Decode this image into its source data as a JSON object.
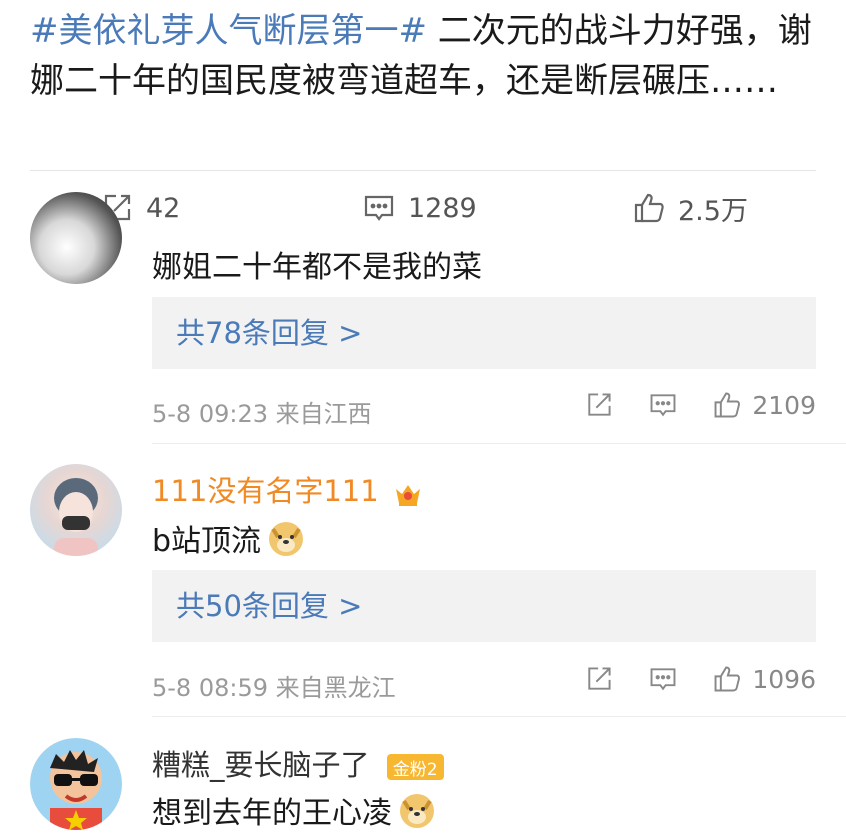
{
  "post": {
    "hashtag": "#美依礼芽人气断层第一#",
    "text": " 二次元的战斗力好强，谢娜二十年的国民度被弯道超车，还是断层碾压……"
  },
  "post_actions": {
    "repost_count": "42",
    "comment_count": "1289",
    "like_count": "2.5万"
  },
  "comments": [
    {
      "username": "",
      "text": "娜姐二十年都不是我的菜",
      "replies": "共78条回复 >",
      "time": "5-8 09:23",
      "location": "来自江西",
      "likes": "2109"
    },
    {
      "username": "111没有名字111",
      "text": "b站顶流",
      "replies": "共50条回复 >",
      "time": "5-8 08:59",
      "location": "来自黑龙江",
      "likes": "1096",
      "name_color": "#f08a24"
    },
    {
      "username": "糟糕_要长脑子了",
      "badge": "金粉2",
      "text": "想到去年的王心凌"
    }
  ],
  "icons": {
    "repost": "repost-icon",
    "comment": "comment-icon",
    "like": "thumbs-up-icon",
    "emoji": "doge-emoji-icon",
    "crown": "crown-icon"
  }
}
